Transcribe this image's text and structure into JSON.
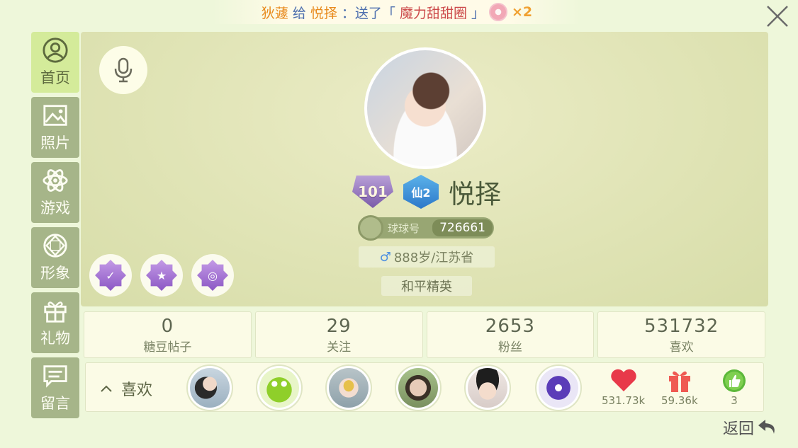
{
  "banner": {
    "sender": "狄蘧",
    "connector": "给",
    "receiver": "悦择",
    "action": "：送了「",
    "gift_name": "魔力甜甜圈",
    "close_quote": "」",
    "count": "×2"
  },
  "sidebar": {
    "items": [
      {
        "label": "首页",
        "icon": "person-icon",
        "active": true
      },
      {
        "label": "照片",
        "icon": "photo-icon"
      },
      {
        "label": "游戏",
        "icon": "atom-icon"
      },
      {
        "label": "形象",
        "icon": "diamond-icon"
      },
      {
        "label": "礼物",
        "icon": "gift-icon"
      },
      {
        "label": "留言",
        "icon": "message-icon"
      }
    ]
  },
  "profile": {
    "level": "101",
    "rank_badge": "仙2",
    "username": "悦择",
    "id_label": "球球号",
    "id_number": "726661",
    "gender_symbol": "♂",
    "age_region": "888岁/江苏省",
    "game_tag": "和平精英"
  },
  "stats": [
    {
      "value": "0",
      "label": "糖豆帖子"
    },
    {
      "value": "29",
      "label": "关注"
    },
    {
      "value": "2653",
      "label": "粉丝"
    },
    {
      "value": "531732",
      "label": "喜欢"
    }
  ],
  "likes": {
    "toggle_label": "喜欢",
    "heart_count": "531.73k",
    "gift_count": "59.36k",
    "thumb_count": "3"
  },
  "back_label": "返回",
  "colors": {
    "accent_green": "#d4eb9a",
    "sidebar_inactive": "#a6b589",
    "heart": "#e8394a",
    "gift": "#ef5a52",
    "thumb": "#5cb83a"
  }
}
